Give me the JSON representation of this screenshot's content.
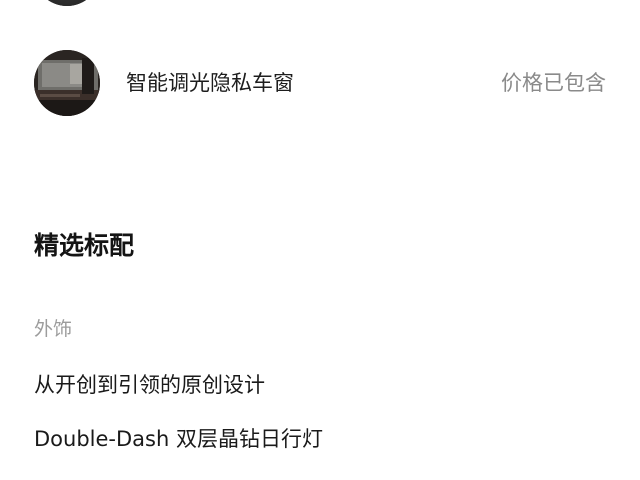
{
  "option": {
    "name": "智能调光隐私车窗",
    "price_note": "价格已包含",
    "thumbnail_icon": "car-interior-photo"
  },
  "standard_section": {
    "title": "精选标配",
    "categories": [
      {
        "label": "外饰",
        "items": [
          "从开创到引领的原创设计",
          "Double-Dash 双层晶钻日行灯"
        ]
      }
    ]
  }
}
